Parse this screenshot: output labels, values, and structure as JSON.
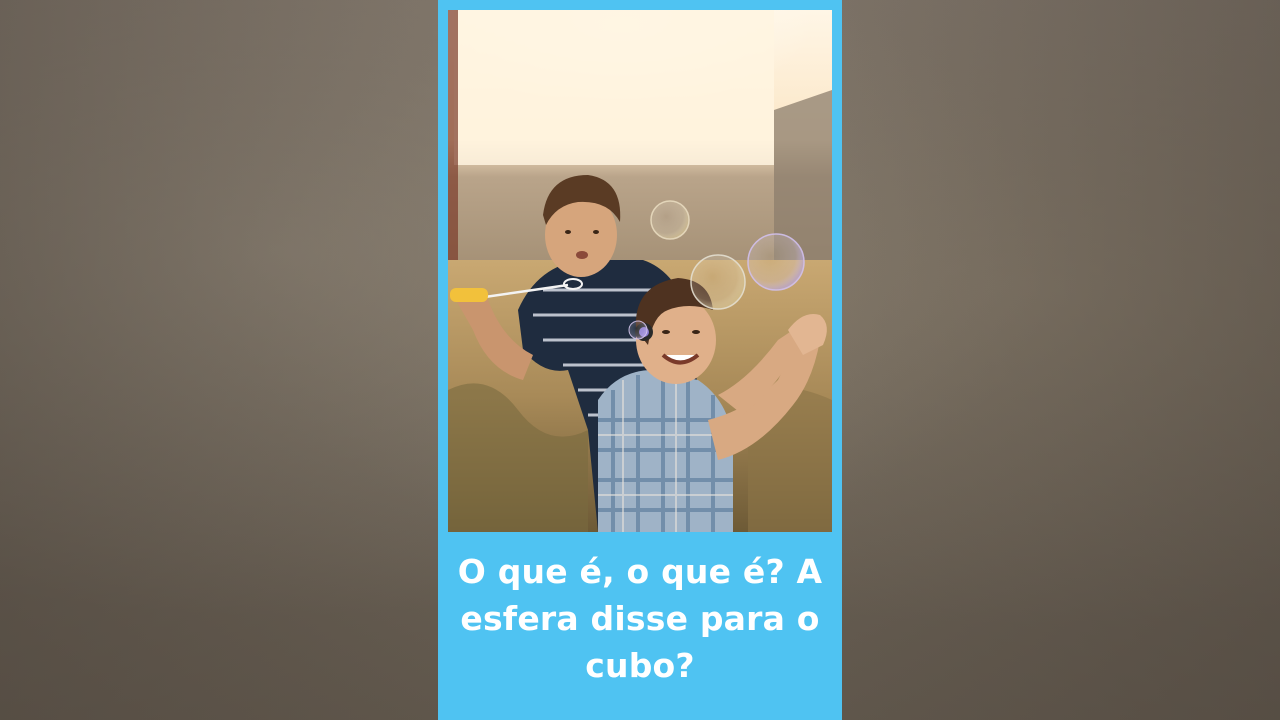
{
  "video": {
    "photo_description_icon": "photo-two-boys-bubbles",
    "caption": "O que é, o que é? A esfera disse para o cubo?"
  },
  "colors": {
    "card_background": "#4fc3f2",
    "caption_text": "#ffffff",
    "letterbox": "#6f6558"
  }
}
